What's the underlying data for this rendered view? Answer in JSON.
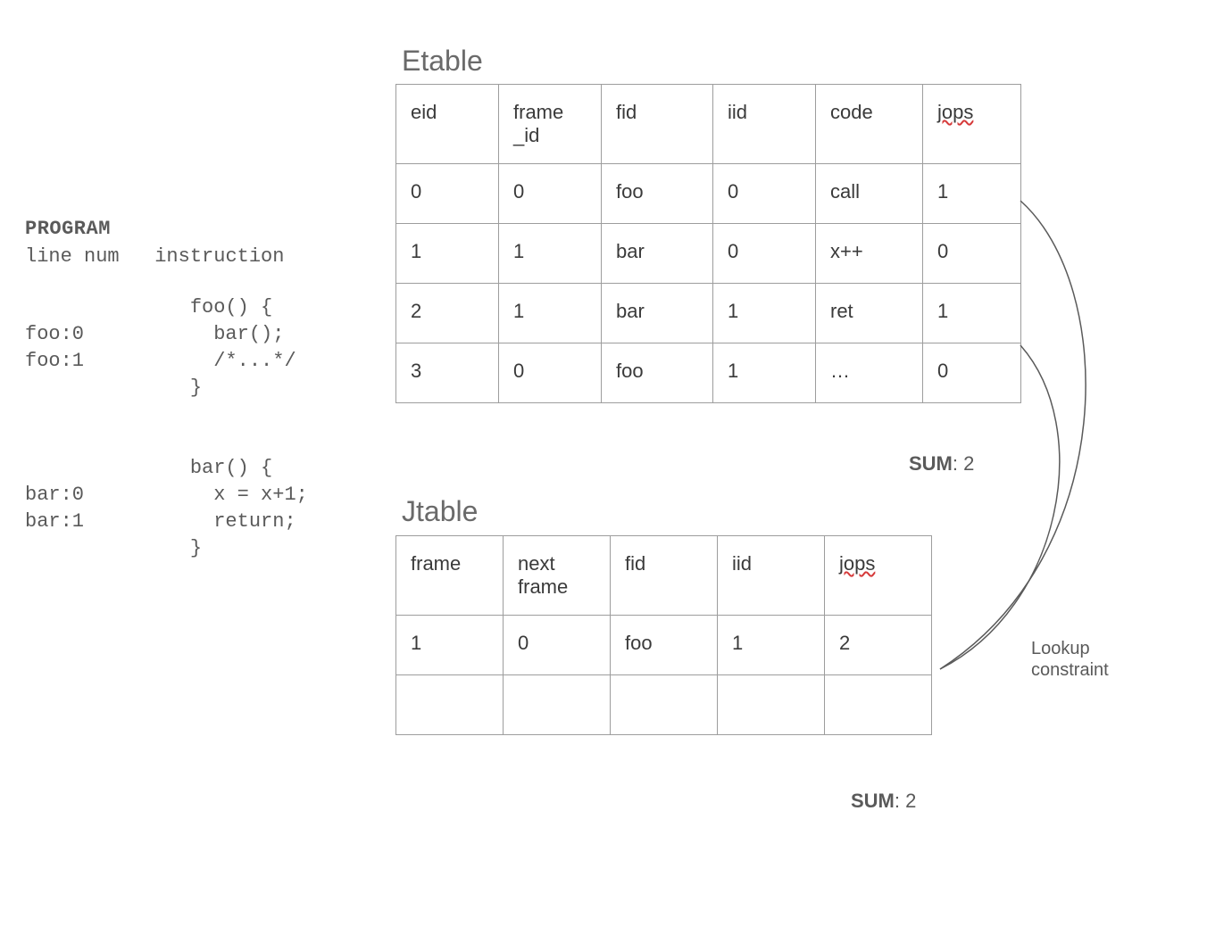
{
  "program": {
    "heading": "PROGRAM",
    "col_linenum": "line num",
    "col_instruction": "instruction",
    "body": "              foo() {\nfoo:0           bar();\nfoo:1           /*...*/\n              }\n\n\n              bar() {\nbar:0           x = x+1;\nbar:1           return;\n              }"
  },
  "etable": {
    "title": "Etable",
    "headers": [
      "eid",
      "frame_id",
      "fid",
      "iid",
      "code",
      "jops"
    ],
    "rows": [
      [
        "0",
        "0",
        "foo",
        "0",
        "call",
        "1"
      ],
      [
        "1",
        "1",
        "bar",
        "0",
        "x++",
        "0"
      ],
      [
        "2",
        "1",
        "bar",
        "1",
        "ret",
        "1"
      ],
      [
        "3",
        "0",
        "foo",
        "1",
        "…",
        "0"
      ]
    ],
    "sum_label": "SUM",
    "sum_value": "2"
  },
  "jtable": {
    "title": "Jtable",
    "headers": [
      "frame",
      "next frame",
      "fid",
      "iid",
      "jops"
    ],
    "rows": [
      [
        "1",
        "0",
        "foo",
        "1",
        "2"
      ],
      [
        "",
        "",
        "",
        "",
        ""
      ]
    ],
    "sum_label": "SUM",
    "sum_value": "2"
  },
  "annotation": {
    "lookup_line1": "Lookup",
    "lookup_line2": "constraint"
  }
}
